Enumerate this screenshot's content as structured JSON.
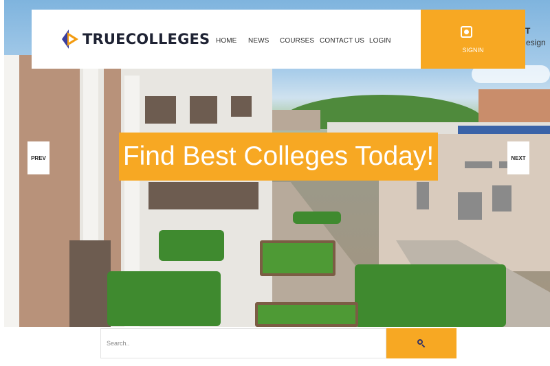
{
  "brand": {
    "name": "TRUECOLLEGES",
    "colors": {
      "accent": "#f7a823",
      "logo_blue": "#3b3f9e",
      "logo_orange": "#f39c12",
      "text_dark": "#1e2233"
    }
  },
  "nav": {
    "items": [
      {
        "label": "HOME"
      },
      {
        "label": "NEWS"
      },
      {
        "label": "COURSES"
      },
      {
        "label": "CONTACT US"
      },
      {
        "label": "LOGIN"
      }
    ]
  },
  "signin": {
    "label": "SIGNIN",
    "icon": "user-square-icon"
  },
  "offpage": {
    "fragment_top": "T",
    "fragment": "esign"
  },
  "slider": {
    "prev_label": "PREV",
    "next_label": "NEXT",
    "title": "Find Best Colleges Today!"
  },
  "search": {
    "placeholder": "Search..",
    "value": "",
    "button_icon": "search-icon"
  }
}
